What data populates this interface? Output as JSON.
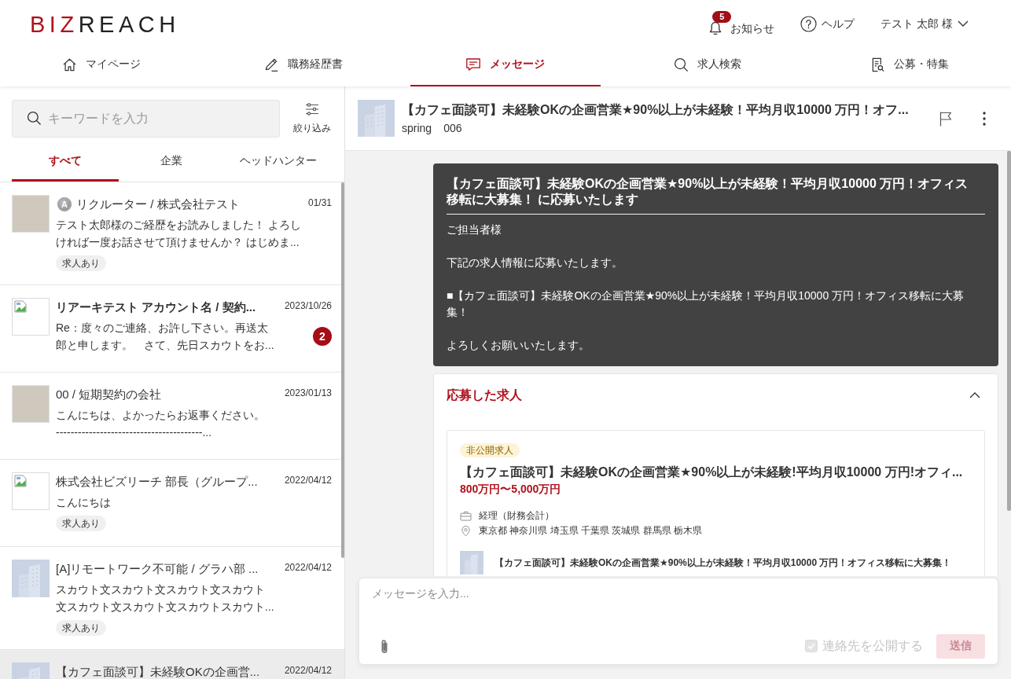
{
  "header": {
    "logo": {
      "accent": "BIZ",
      "rest": "REACH"
    },
    "notifications": {
      "label": "お知らせ",
      "badge": "5"
    },
    "help": {
      "label": "ヘルプ"
    },
    "user_menu": {
      "label": "テスト 太郎 様"
    }
  },
  "nav": [
    {
      "label": "マイページ",
      "selected": false
    },
    {
      "label": "職務経歴書",
      "selected": false
    },
    {
      "label": "メッセージ",
      "selected": true
    },
    {
      "label": "求人検索",
      "selected": false
    },
    {
      "label": "公募・特集",
      "selected": false
    }
  ],
  "sidebar": {
    "search": {
      "placeholder": "キーワードを入力"
    },
    "filter_button": {
      "label": "絞り込み"
    },
    "tabs": [
      {
        "label": "すべて",
        "selected": true
      },
      {
        "label": "企業",
        "selected": false
      },
      {
        "label": "ヘッドハンター",
        "selected": false
      }
    ],
    "threads": [
      {
        "kind": "photo",
        "badge": "A",
        "name": "リクルーター / 株式会社テスト",
        "date": "01/31",
        "preview": [
          "テスト太郎様のご経歴をお読みしました！ よろしければ一度お話させて頂けませんか？ はじめま..."
        ],
        "tag": "求人あり",
        "unread": false,
        "selected": false
      },
      {
        "kind": "broken",
        "name": "リアーキテスト アカウント名 / 契約...",
        "date": "2023/10/26",
        "preview": [
          "Re：度々のご連絡、お許し下さい。再送太郎と申します。　さて、先日スカウトをお..."
        ],
        "unread_count": "2",
        "unread": true,
        "selected": false
      },
      {
        "kind": "photo",
        "name": "00 / 短期契約の会社",
        "date": "2023/01/13",
        "preview": [
          "こんにちは、よかったらお返事ください。",
          "----------------------------------------..."
        ],
        "unread": false,
        "selected": false
      },
      {
        "kind": "broken",
        "name": "株式会社ビズリーチ 部長（グループ...",
        "date": "2022/04/12",
        "preview": [
          "こんにちは"
        ],
        "tag": "求人あり",
        "unread": false,
        "selected": false
      },
      {
        "kind": "building",
        "name": "[A]リモートワーク不可能 / グラハ部 ...",
        "date": "2022/04/12",
        "preview": [
          "スカウト文スカウト文スカウト文スカウト",
          "文スカウト文スカウト文スカウトスカウト..."
        ],
        "tag": "求人あり",
        "unread": false,
        "selected": false
      },
      {
        "kind": "building",
        "name": "【カフェ面談可】未経験OKの企画営...",
        "date": "2022/04/12",
        "unread": false,
        "selected": true
      }
    ]
  },
  "conversation": {
    "header": {
      "title": "【カフェ面談可】未経験OKの企画営業★90%以上が未経験！平均月収10000 万円！オフ...",
      "subtitle": [
        "spring",
        "006"
      ]
    },
    "message": {
      "title": "【カフェ面談可】未経験OKの企画営業★90%以上が未経験！平均月収10000 万円！オフィス移転に大募集！ に応募いたします",
      "body": [
        "ご担当者様",
        "下記の求人情報に応募いたします。",
        "■【カフェ面談可】未経験OKの企画営業★90%以上が未経験！平均月収10000 万円！オフィス移転に大募集！",
        "よろしくお願いいたします。"
      ]
    },
    "applied_jobs": {
      "heading": "応募した求人",
      "expanded": true,
      "job": {
        "tag": "非公開求人",
        "title": "【カフェ面談可】未経験OKの企画営業★90%以上が未経験!平均月収10000 万円!オフィ...",
        "salary": "800万円〜5,000万円",
        "occupation": "経理（財務会計）",
        "locations": "東京都 神奈川県 埼玉県 千葉県 茨城県 群馬県 栃木県",
        "linked_title": "【カフェ面談可】未経験OKの企画営業★90%以上が未経験！平均月収10000 万円！オフィス移転に大募集！"
      }
    }
  },
  "composer": {
    "placeholder": "メッセージを入力...",
    "share_contact": {
      "label": "連絡先を公開する",
      "checked": true,
      "disabled": true
    },
    "send_button": {
      "label": "送信",
      "disabled": true
    }
  }
}
